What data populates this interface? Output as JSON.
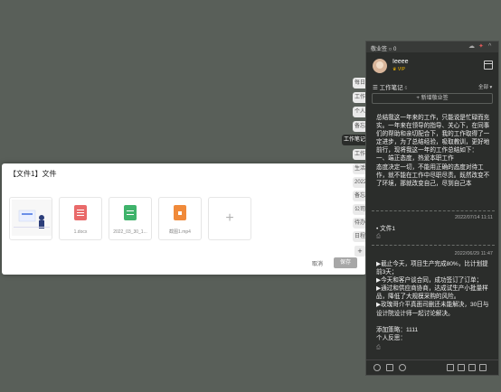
{
  "dialog": {
    "title": "【文件1】文件",
    "files": [
      {
        "name": ""
      },
      {
        "name": "1.docx"
      },
      {
        "name": "2022_03_30_1..."
      },
      {
        "name": "截图1.mp4"
      }
    ],
    "add": "+",
    "cancel": "取消",
    "save": "保存"
  },
  "side_tabs": [
    "每日",
    "工作",
    "个人",
    "备忘",
    "工作笔记",
    "工作",
    "生活",
    "2022",
    "备忘",
    "公司",
    "待办",
    "日程"
  ],
  "panel": {
    "title": "敬业签",
    "counter": "0",
    "username": "Ieeee",
    "vip": "VIP",
    "section": "工作笔记",
    "section_count": "6",
    "filter": "全部",
    "new_button": "+ 新增敬业签",
    "note1": "总结我这一年来的工作，只能说是忙碌而充实。一年来在领导的指导、关心下，在同事们的帮助和亲切配合下，我的工作取得了一定进步，为了总结经验，吸取教训，更好地前行，现将我这一年的工作总结如下：\n一、端正态度，热爱本职工作\n态度决定一切，不能用正确的态度对待工作，就不能在工作中尽职尽责。既然改变不了环境，那就改变自己，尽到自己本",
    "note2_date": "2022/07/14 11:11",
    "note2_text": "文件1",
    "note3_date": "2022/06/29 11:47",
    "note3_text": "▶截止今天，项目生产完成80%，比计划提前3天；\n▶今天和客户谈合同，成功签订了订单；\n▶通过和供应商协商，达成试生产小批量样品，降低了大规模采购的风险。\n▶玫瑰哥介平真面司删还未能解决，30日与设计院设计师一起讨论解决。\n\n添加策略：1111\n个人反思："
  }
}
